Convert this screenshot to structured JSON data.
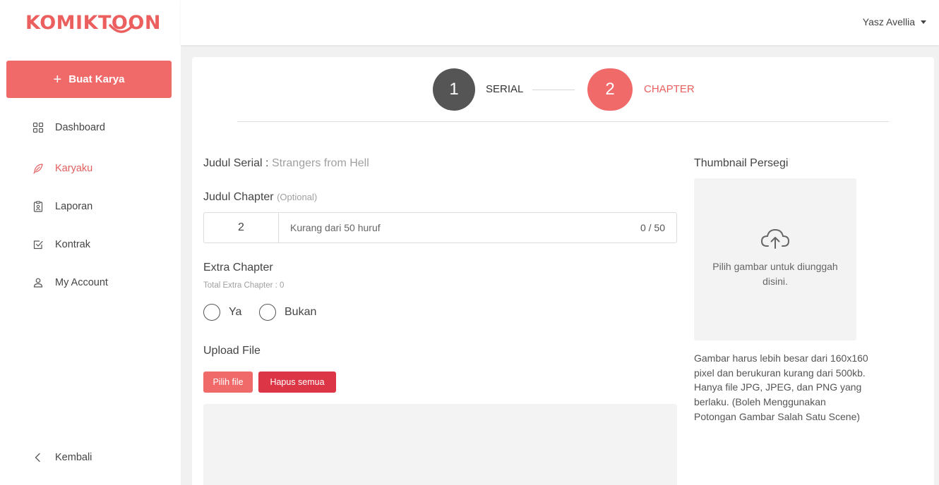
{
  "brand": {
    "name": "KOMIKTOON",
    "color": "#ec5f5f"
  },
  "sidebar": {
    "create_button": {
      "icon": "plus-icon",
      "label": "Buat Karya"
    },
    "items": [
      {
        "icon": "grid-icon",
        "label": "Dashboard"
      },
      {
        "icon": "feather-icon",
        "label": "Karyaku",
        "active": true
      },
      {
        "icon": "report-icon",
        "label": "Laporan"
      },
      {
        "icon": "checkbox-icon",
        "label": "Kontrak"
      },
      {
        "icon": "user-icon",
        "label": "My Account"
      }
    ],
    "back": {
      "icon": "chevron-left-icon",
      "label": "Kembali"
    }
  },
  "header": {
    "user_name": "Yasz Avellia"
  },
  "stepper": {
    "steps": [
      {
        "number": "1",
        "label": "SERIAL",
        "state": "done"
      },
      {
        "number": "2",
        "label": "CHAPTER",
        "state": "active"
      }
    ]
  },
  "form": {
    "series_label": "Judul Serial :",
    "series_value": "Strangers from Hell",
    "chapter_label": "Judul Chapter",
    "chapter_optional": "(Optional)",
    "chapter_number": "2",
    "chapter_placeholder": "Kurang dari 50 huruf",
    "chapter_count": "0 / 50",
    "extra_label": "Extra Chapter",
    "extra_note": "Total Extra Chapter : 0",
    "extra_options": [
      "Ya",
      "Bukan"
    ],
    "upload_label": "Upload File",
    "pick_file": "Pilih file",
    "clear_all": "Hapus semua"
  },
  "thumbnail": {
    "label": "Thumbnail Persegi",
    "icon": "cloud-upload-icon",
    "placeholder": "Pilih gambar untuk diunggah disini.",
    "note": "Gambar harus lebih besar dari 160x160 pixel dan berukuran kurang dari 500kb. Hanya file JPG, JPEG, dan PNG yang berlaku. (Boleh Menggunakan Potongan Gambar Salah Satu Scene)"
  },
  "colors": {
    "accent": "#f06a6a",
    "danger": "#dc3545",
    "step_done": "#555555"
  }
}
